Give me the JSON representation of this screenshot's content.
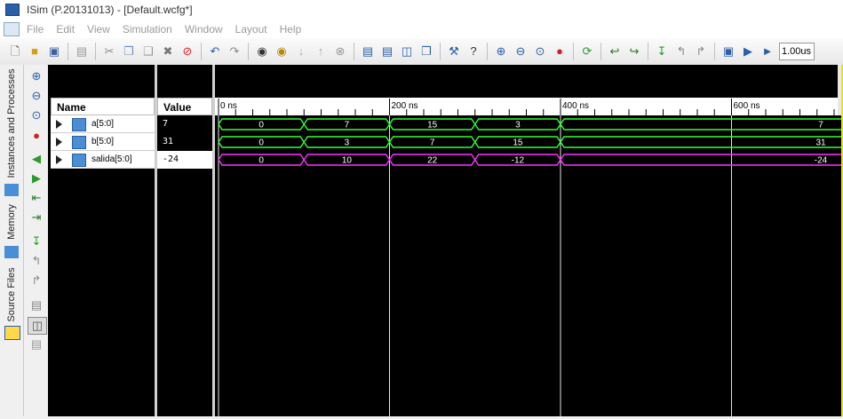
{
  "window": {
    "title": "ISim (P.20131013) - [Default.wcfg*]"
  },
  "menu": [
    "File",
    "Edit",
    "View",
    "Simulation",
    "Window",
    "Layout",
    "Help"
  ],
  "toolbar": {
    "icons": [
      "new-file-icon",
      "open-folder-icon",
      "save-icon",
      "print-icon",
      "cut-icon",
      "copy-icon",
      "paste-icon",
      "delete-icon",
      "stop-icon",
      "undo-icon",
      "redo-icon",
      "find-icon",
      "find-next-icon",
      "arrow-down-icon",
      "arrow-up-icon",
      "cancel-icon",
      "cascade-windows-icon",
      "tile-horizontal-icon",
      "tile-vertical-icon",
      "arrange-icon",
      "wrench-icon",
      "help-cursor-icon",
      "zoom-in-icon",
      "zoom-out-icon",
      "zoom-fit-icon",
      "zoom-full-icon",
      "refresh-icon",
      "restart-icon",
      "run-icon",
      "step-icon",
      "step-over-icon",
      "step-back-icon",
      "relaunch-icon",
      "run-all-icon",
      "run-for-icon"
    ],
    "zoom_value": "1.00us"
  },
  "side_tabs": [
    "Instances and Processes",
    "Memory",
    "Source Files"
  ],
  "columns": {
    "name": "Name",
    "value": "Value"
  },
  "signals": [
    {
      "name": "a[5:0]",
      "value": "7",
      "color": "#33ff33",
      "segments": [
        {
          "start": 0,
          "end": 100,
          "label": "0"
        },
        {
          "start": 100,
          "end": 200,
          "label": "7"
        },
        {
          "start": 200,
          "end": 300,
          "label": "15"
        },
        {
          "start": 300,
          "end": 400,
          "label": "3"
        },
        {
          "start": 400,
          "end": 1000,
          "label": "7"
        }
      ]
    },
    {
      "name": "b[5:0]",
      "value": "31",
      "color": "#33ff33",
      "segments": [
        {
          "start": 0,
          "end": 100,
          "label": "0"
        },
        {
          "start": 100,
          "end": 200,
          "label": "3"
        },
        {
          "start": 200,
          "end": 300,
          "label": "7"
        },
        {
          "start": 300,
          "end": 400,
          "label": "15"
        },
        {
          "start": 400,
          "end": 1000,
          "label": "31"
        }
      ]
    },
    {
      "name": "salida[5:0]",
      "value": "-24",
      "color": "#ff33ff",
      "segments": [
        {
          "start": 0,
          "end": 100,
          "label": "0"
        },
        {
          "start": 100,
          "end": 200,
          "label": "10"
        },
        {
          "start": 200,
          "end": 300,
          "label": "22"
        },
        {
          "start": 300,
          "end": 400,
          "label": "-12"
        },
        {
          "start": 400,
          "end": 1000,
          "label": "-24"
        }
      ]
    }
  ],
  "timeline": {
    "view_range_ns": [
      0,
      730
    ],
    "major_labels": [
      {
        "t": 0,
        "label": "0 ns"
      },
      {
        "t": 200,
        "label": "200 ns"
      },
      {
        "t": 400,
        "label": "400 ns"
      },
      {
        "t": 600,
        "label": "600 ns"
      }
    ],
    "grid_color": "#ffffff"
  }
}
